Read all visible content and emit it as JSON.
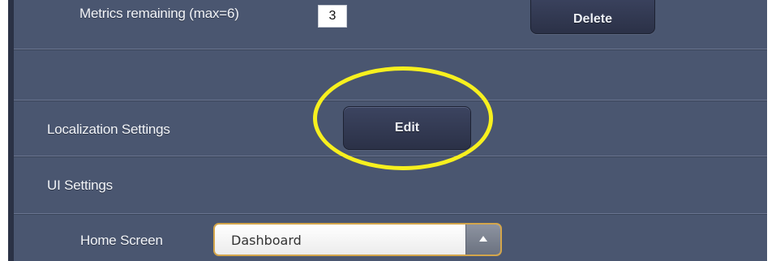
{
  "metrics": {
    "label": "Metrics remaining (max=6)",
    "value": "3",
    "delete_label": "Delete"
  },
  "localization": {
    "label": "Localization Settings",
    "edit_label": "Edit"
  },
  "ui_settings": {
    "label": "UI Settings",
    "home_screen": {
      "label": "Home Screen",
      "selected": "Dashboard",
      "icon": "chevron-up-icon"
    }
  },
  "colors": {
    "panel": "#4a5670",
    "highlight": "#f7f01e",
    "select_border": "#d3a54b"
  }
}
